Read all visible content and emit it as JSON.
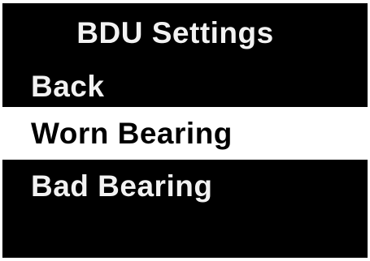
{
  "screen": {
    "title": "BDU Settings",
    "background_color": "#000000",
    "text_color": "#f2f2f2",
    "selected_background_color": "#ffffff",
    "selected_text_color": "#000000"
  },
  "menu": {
    "items": [
      {
        "label": "Back",
        "selected": false
      },
      {
        "label": "Worn Bearing",
        "selected": true
      },
      {
        "label": "Bad Bearing",
        "selected": false
      }
    ]
  }
}
